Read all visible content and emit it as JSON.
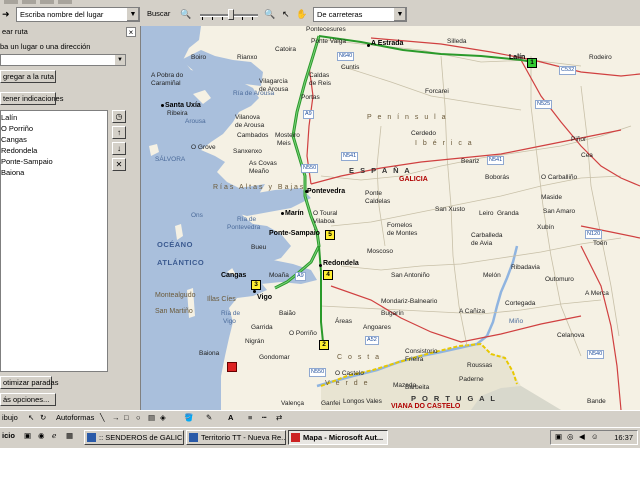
{
  "toolbar": {
    "place_placeholder": "Escriba nombre del lugar",
    "search_label": "Buscar",
    "map_style": "De carreteras"
  },
  "panel": {
    "title": "ear ruta",
    "add_place_label": "ba un lugar o una dirección",
    "add_button": "gregar a la ruta",
    "directions_button": "tener indicaciones",
    "route": [
      "Lalín",
      "O Porriño",
      "Cangas",
      "Redondela",
      "Ponte-Sampaio",
      "Baiona"
    ],
    "optimize_button": "otimizar paradas",
    "more_options_button": "ás opciones..."
  },
  "map": {
    "places": {
      "pontecesures": "Pontecesures",
      "ponte_valga": "Ponte Valga",
      "a_estrada": "A Estrada",
      "silleda": "Silleda",
      "catoira": "Catoira",
      "boiro": "Boiro",
      "rianxo": "Rianxo",
      "lalin": "Lalín",
      "rodeiro": "Rodeiro",
      "cuntis": "Cuntis",
      "caldas": "Caldas",
      "de_reis": "de Reis",
      "a_pobra": "A Pobra do",
      "caraminal": "Caramiñal",
      "vilagarcia": "Vilagarcía",
      "de_arousa": "de Arousa",
      "portas": "Portas",
      "forcarei": "Forcarei",
      "santa_uxia": "Santa Uxía",
      "ribeira": "Ribeira",
      "arousa": "Arousa",
      "vilanova": "Vilanova",
      "vilanova_arousa": "de Arousa",
      "cambados": "Cambados",
      "meis": "Meis",
      "mosteiro": "Mosteiro",
      "o_grove": "O Grove",
      "cerdedo": "Cerdedo",
      "pinor": "Piñor",
      "cea": "Cea",
      "salvora": "SÁLVORA",
      "as_covas": "As Covas",
      "meano": "Meaño",
      "sanxenxo": "Sanxenxo",
      "beariz": "Beariz",
      "o_carballino": "O Carballiño",
      "pontevedra": "Pontevedra",
      "espana": "E S P A Ñ A",
      "galicia": "GALICIA",
      "boborás": "Boborás",
      "ons": "Ons",
      "marin": "Marín",
      "o_toural": "O Toural",
      "vilaboa": "Vilaboa",
      "ponte_caldelas": "Ponte",
      "caldelas": "Caldelas",
      "san_xusto": "San Xusto",
      "leiro": "Leiro",
      "granda": "Granda",
      "maside": "Maside",
      "san_amaro": "San Amaro",
      "ponte_sampaio": "Ponte-Sampaio",
      "fornelos": "Fornelos",
      "de_montes": "de Montes",
      "carballeda": "Carballeda",
      "de_avia": "de Avia",
      "xubin": "Xubín",
      "toen": "Toén",
      "bueu": "Bueu",
      "moscoso": "Moscoso",
      "redondela": "Redondela",
      "ribadavia": "Ribadavia",
      "oceano": "OCÉANO",
      "atlantico": "ATLÁNTICO",
      "cangas": "Cangas",
      "moana": "Moaña",
      "san_antonio": "San Antoniño",
      "melon": "Melón",
      "outomuro": "Outomuro",
      "vigo": "Vigo",
      "a_merca": "A Merca",
      "cortegada": "Cortegada",
      "mondariz": "Mondariz-Balneario",
      "montealgudo": "Montealgudo",
      "illas_cies": "Illas Cíes",
      "san_martino": "San Martiño",
      "bugarin": "Bugarín",
      "a_caniza": "A Cañiza",
      "areas": "Áreas",
      "angoares": "Angoares",
      "celanova": "Celanova",
      "garrida": "Garrida",
      "o_porrino": "O Porriño",
      "baiao": "Baião",
      "nigran": "Nigrán",
      "gondomar": "Gondomar",
      "baiona": "Baiona",
      "costa": "C o s t a",
      "consistorio": "Consistorio",
      "frieira": "Frieira",
      "roussas": "Roussas",
      "o_castelo": "O Castelo",
      "verde": "V e r d e",
      "mazedo": "Mazedo",
      "barbeita": "Barbeita",
      "paderne": "Paderne",
      "portugal": "P O R T U G A L",
      "viana": "VIANA DO CASTELO",
      "valenca": "Valença",
      "ganfei": "Ganfei",
      "longos_vales": "Longos Vales",
      "bande": "Bande",
      "tui": "Tui",
      "minho": "Miño",
      "peninsula": "P e n í n s u l a",
      "iberica": "I b é r i c a",
      "ria_arousa": "Ría de Arousa",
      "ria_pontevedra": "Ría de",
      "ria_pontevedra2": "Pontevedra",
      "ria_vigo": "Ría de",
      "ria_vigo2": "Vigo",
      "rias_altas": "Rías Altas y Bajas"
    },
    "roads": [
      "N640",
      "C532",
      "N525",
      "N550",
      "A9",
      "N541",
      "N120",
      "A52",
      "N540",
      "N555",
      "N550"
    ],
    "stops": [
      "1",
      "2",
      "3",
      "4",
      "5"
    ]
  },
  "draw": {
    "draw_label": "ibujo",
    "autoshapes_label": "Autoformas"
  },
  "taskbar": {
    "start_fragment": "icio",
    "tasks": [
      ":: SENDEROS de GALICI...",
      "Territorio TT - Nueva Re...",
      "Mapa - Microsoft Aut..."
    ],
    "clock": "16:37"
  },
  "colors": {
    "sea": "#a9bfdc",
    "land": "#f5f1e4",
    "route": "#2a9a2a",
    "border": "#e8c800"
  }
}
